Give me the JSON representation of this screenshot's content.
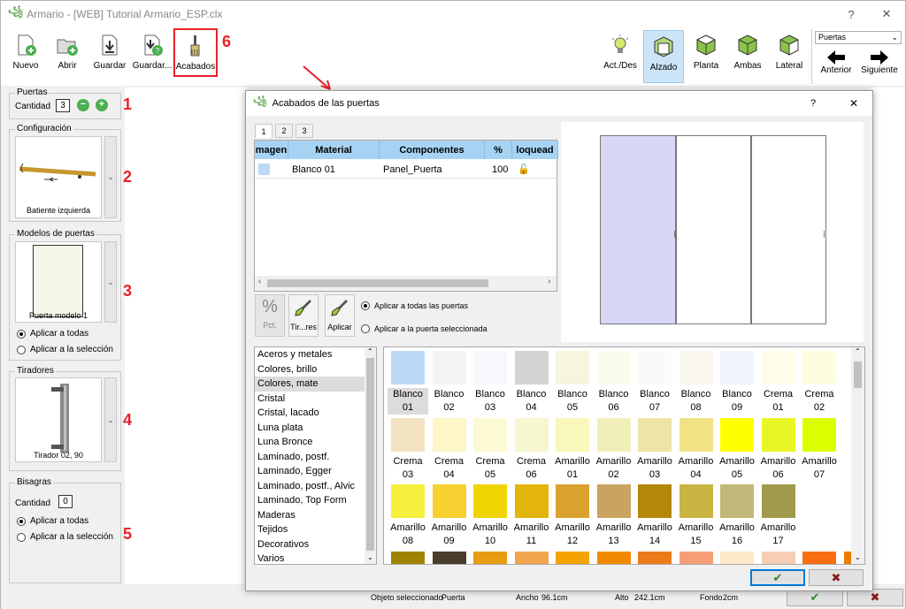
{
  "window": {
    "title": "Armario - [WEB] Tutorial Armario_ESP.clx",
    "help": "?",
    "close": "✕"
  },
  "toolbar": {
    "items": [
      {
        "label": "Nuevo",
        "icon": "new-file-icon"
      },
      {
        "label": "Abrir",
        "icon": "open-folder-icon"
      },
      {
        "label": "Guardar",
        "icon": "save-icon"
      },
      {
        "label": "Guardar...",
        "icon": "save-as-icon"
      },
      {
        "label": "Acabados",
        "icon": "paint-brush-icon"
      }
    ],
    "views": [
      {
        "label": "Act./Des",
        "icon": "lightbulb-icon"
      },
      {
        "label": "Alzado",
        "icon": "cube-front-icon",
        "active": true
      },
      {
        "label": "Planta",
        "icon": "cube-top-icon"
      },
      {
        "label": "Ambas",
        "icon": "cube-both-icon"
      },
      {
        "label": "Lateral",
        "icon": "cube-side-icon"
      }
    ],
    "select_value": "Puertas",
    "prev_label": "Anterior",
    "next_label": "Siguiente"
  },
  "annotations": [
    "1",
    "2",
    "3",
    "4",
    "5",
    "6"
  ],
  "left": {
    "puertas": {
      "title": "Puertas",
      "cantidad_label": "Cantidad",
      "cantidad": "3"
    },
    "configuracion": {
      "title": "Configuración",
      "caption": "Batiente izquierda"
    },
    "modelos": {
      "title": "Modelos de puertas",
      "caption": "Puerta modelo 1",
      "radio1": "Aplicar a todas",
      "radio2": "Aplicar a la selección"
    },
    "tiradores": {
      "title": "Tiradores",
      "caption": "Tirador 02, 90"
    },
    "bisagras": {
      "title": "Bisagras",
      "cantidad_label": "Cantidad",
      "cantidad": "0",
      "radio1": "Aplicar a todas",
      "radio2": "Aplicar a la selección"
    }
  },
  "status": {
    "obj_label": "Objeto seleccionado",
    "obj_value": "Puerta",
    "ancho_label": "Ancho",
    "ancho_value": "96.1cm",
    "alto_label": "Alto",
    "alto_value": "242.1cm",
    "fondo_label": "Fondo",
    "fondo_value": "2cm"
  },
  "dialog": {
    "title": "Acabados de las puertas",
    "help": "?",
    "close": "✕",
    "tabs": [
      "1",
      "2",
      "3"
    ],
    "columns": [
      "magen",
      "Material",
      "Componentes",
      "%",
      "loquead"
    ],
    "row": {
      "material": "Blanco 01",
      "componente": "Panel_Puerta",
      "pct": "100"
    },
    "buttons": {
      "pct": "Pct.",
      "tiradores": "Tir...res",
      "aplicar": "Aplicar"
    },
    "radio_all": "Aplicar a todas las puertas",
    "radio_sel": "Aplicar a la puerta seleccionada",
    "categories": [
      "Aceros y metales",
      "Colores, brillo",
      "Colores, mate",
      "Cristal",
      "Cristal, lacado",
      "Luna plata",
      "Luna Bronce",
      "Laminado, postf.",
      "Laminado, Egger",
      "Laminado, postf., Alvic",
      "Laminado, Top Form",
      "Maderas",
      "Tejidos",
      "Decorativos",
      "Varios"
    ],
    "selected_category": "Colores, mate",
    "swatches": [
      [
        {
          "n": "Blanco",
          "m": "01",
          "c": "#bcdaf7"
        },
        {
          "n": "Blanco",
          "m": "02",
          "c": "#f4f4f4"
        },
        {
          "n": "Blanco",
          "m": "03",
          "c": "#f6f8fe"
        },
        {
          "n": "Blanco",
          "m": "04",
          "c": "#d3d3d3"
        },
        {
          "n": "Blanco",
          "m": "05",
          "c": "#f6f6df"
        },
        {
          "n": "Blanco",
          "m": "06",
          "c": "#fcfced"
        },
        {
          "n": "Blanco",
          "m": "07",
          "c": "#fbfafa"
        },
        {
          "n": "Blanco",
          "m": "08",
          "c": "#f8f6ee"
        },
        {
          "n": "Blanco",
          "m": "09",
          "c": "#f1f5fd"
        },
        {
          "n": "Crema",
          "m": "01",
          "c": "#fdfdea"
        },
        {
          "n": "Crema",
          "m": "02",
          "c": "#fdfde0"
        }
      ],
      [
        {
          "n": "Crema",
          "m": "03",
          "c": "#f2e2c2"
        },
        {
          "n": "Crema",
          "m": "04",
          "c": "#fdf6c6"
        },
        {
          "n": "Crema",
          "m": "05",
          "c": "#fcfad4"
        },
        {
          "n": "Crema",
          "m": "06",
          "c": "#f6f6d0"
        },
        {
          "n": "Amarillo",
          "m": "01",
          "c": "#f9f7b9"
        },
        {
          "n": "Amarillo",
          "m": "02",
          "c": "#f0efb8"
        },
        {
          "n": "Amarillo",
          "m": "03",
          "c": "#ece5a6"
        },
        {
          "n": "Amarillo",
          "m": "04",
          "c": "#f0e285"
        },
        {
          "n": "Amarillo",
          "m": "05",
          "c": "#ffff00"
        },
        {
          "n": "Amarillo",
          "m": "06",
          "c": "#eaf526"
        },
        {
          "n": "Amarillo",
          "m": "07",
          "c": "#dcff00"
        }
      ],
      [
        {
          "n": "Amarillo",
          "m": "08",
          "c": "#f6ef3c"
        },
        {
          "n": "Amarillo",
          "m": "09",
          "c": "#f6d131"
        },
        {
          "n": "Amarillo",
          "m": "10",
          "c": "#f1d500"
        },
        {
          "n": "Amarillo",
          "m": "11",
          "c": "#e3b409"
        },
        {
          "n": "Amarillo",
          "m": "12",
          "c": "#dba12e"
        },
        {
          "n": "Amarillo",
          "m": "13",
          "c": "#c9a360"
        },
        {
          "n": "Amarillo",
          "m": "14",
          "c": "#b38708"
        },
        {
          "n": "Amarillo",
          "m": "15",
          "c": "#c9b441"
        },
        {
          "n": "Amarillo",
          "m": "16",
          "c": "#c0b878"
        },
        {
          "n": "Amarillo",
          "m": "17",
          "c": "#a1994c"
        }
      ],
      [
        {
          "n": "",
          "m": "",
          "c": "#a08400"
        },
        {
          "n": "",
          "m": "",
          "c": "#4a3c2a"
        },
        {
          "n": "",
          "m": "",
          "c": "#e89c12"
        },
        {
          "n": "",
          "m": "",
          "c": "#f1a54c"
        },
        {
          "n": "",
          "m": "",
          "c": "#f5a300"
        },
        {
          "n": "",
          "m": "",
          "c": "#f28a00"
        },
        {
          "n": "",
          "m": "",
          "c": "#ec7b1a"
        },
        {
          "n": "",
          "m": "",
          "c": "#f79e78"
        },
        {
          "n": "",
          "m": "",
          "c": "#fde8c8"
        },
        {
          "n": "",
          "m": "",
          "c": "#f5ceb5"
        },
        {
          "n": "",
          "m": "",
          "c": "#f86e10"
        },
        {
          "n": "",
          "m": "",
          "c": "#ef7a00"
        }
      ]
    ],
    "ok": "✔",
    "cancel": "✖"
  }
}
